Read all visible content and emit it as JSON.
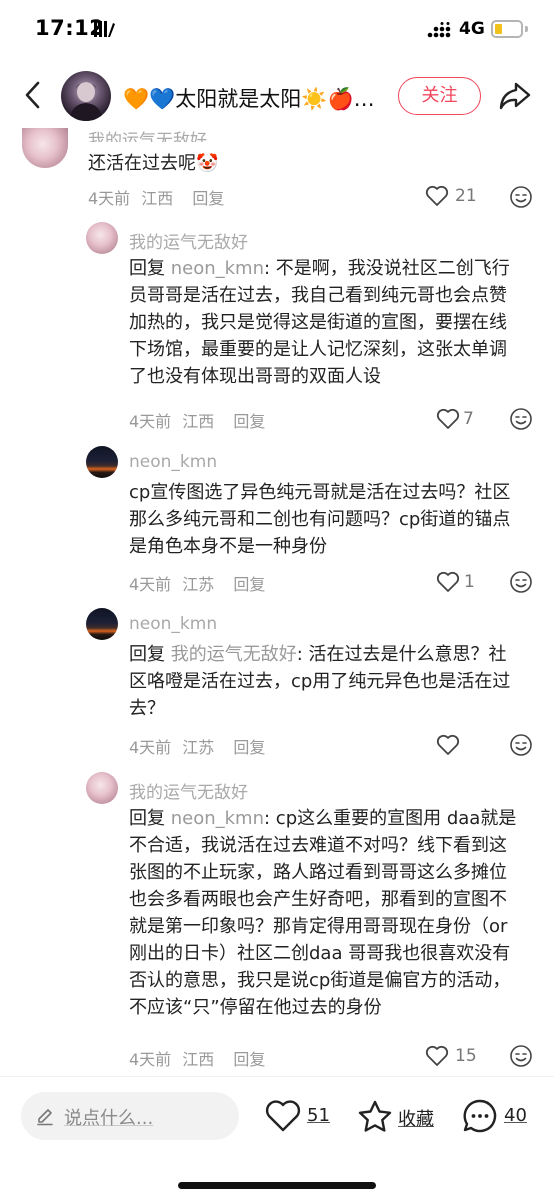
{
  "status_bar": {
    "time": "17:12",
    "network": "4G",
    "battery_level": 0.2
  },
  "header": {
    "title": "🧡💙太阳就是太阳☀️🍎…",
    "follow_label": "关注"
  },
  "comments": [
    {
      "username": "我的运气无敌好",
      "text": "还活在过去呢🤡",
      "time": "4天前",
      "location": "江西",
      "reply_label": "回复",
      "likes": "21"
    },
    {
      "username": "我的运气无敌好",
      "reply_prefix": "回复 ",
      "reply_target": "neon_kmn",
      "text": ": 不是啊，我没说社区二创飞行员哥哥是活在过去，我自己看到纯元哥也会点赞加热的，我只是觉得这是街道的宣图，要摆在线下场馆，最重要的是让人记忆深刻，这张太单调了也没有体现出哥哥的双面人设",
      "time": "4天前",
      "location": "江西",
      "reply_label": "回复",
      "likes": "7"
    },
    {
      "username": "neon_kmn",
      "text": "cp宣传图选了异色纯元哥就是活在过去吗？社区那么多纯元哥和二创也有问题吗？cp街道的锚点是角色本身不是一种身份",
      "time": "4天前",
      "location": "江苏",
      "reply_label": "回复",
      "likes": "1"
    },
    {
      "username": "neon_kmn",
      "reply_prefix": "回复 ",
      "reply_target": "我的运气无敌好",
      "text": ": 活在过去是什么意思？社区咯噔是活在过去，cp用了纯元异色也是活在过去？",
      "time": "4天前",
      "location": "江苏",
      "reply_label": "回复",
      "likes": ""
    },
    {
      "username": "我的运气无敌好",
      "reply_prefix": "回复 ",
      "reply_target": "neon_kmn",
      "text": ": cp这么重要的宣图用 daa就是不合适，我说活在过去难道不对吗？线下看到这张图的不止玩家，路人路过看到哥哥这么多摊位也会多看两眼也会产生好奇吧，那看到的宣图不就是第一印象吗？那肯定得用哥哥现在身份（or 刚出的日卡）社区二创daa 哥哥我也很喜欢没有否认的意思，我只是说cp街道是偏官方的活动，不应该“只”停留在他过去的身份",
      "time": "4天前",
      "location": "江西",
      "reply_label": "回复",
      "likes": "15"
    }
  ],
  "bottom_bar": {
    "input_placeholder": "说点什么...",
    "likes": "51",
    "collect_label": "收藏",
    "comments": "40"
  }
}
